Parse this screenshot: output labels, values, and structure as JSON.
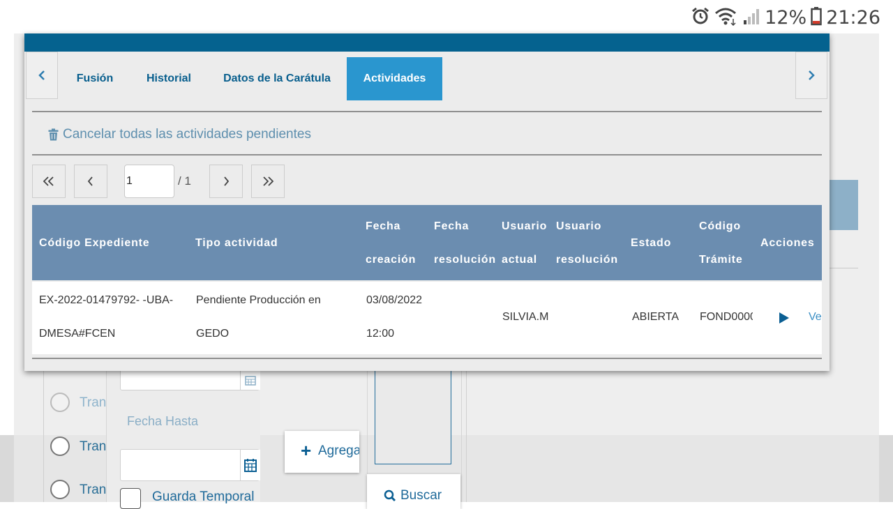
{
  "status_bar": {
    "battery": "12%",
    "time": "21:26"
  },
  "modal": {
    "tabs": [
      {
        "label": "Fusión",
        "active": false
      },
      {
        "label": "Historial",
        "active": false
      },
      {
        "label": "Datos de la Carátula",
        "active": false
      },
      {
        "label": "Actividades",
        "active": true
      }
    ],
    "cancel_all_label": "Cancelar todas las actividades pendientes",
    "pagination": {
      "page": "1",
      "total": "/ 1"
    },
    "table": {
      "headers": [
        {
          "l1": "Código Expediente",
          "l2": ""
        },
        {
          "l1": "Tipo actividad",
          "l2": ""
        },
        {
          "l1": "Fecha",
          "l2": "creación"
        },
        {
          "l1": "Fecha",
          "l2": "resolución"
        },
        {
          "l1": "Usuario",
          "l2": "actual"
        },
        {
          "l1": "Usuario",
          "l2": "resolución"
        },
        {
          "l1": "Estado",
          "l2": ""
        },
        {
          "l1": "Código",
          "l2": "Trámite"
        },
        {
          "l1": "Acciones",
          "l2": ""
        }
      ],
      "rows": [
        {
          "codigo_l1": "EX-2022-01479792- -UBA-",
          "codigo_l2": "DMESA#FCEN",
          "tipo_l1": "Pendiente Producción en",
          "tipo_l2": "GEDO",
          "fecha_creacion_l1": "03/08/2022",
          "fecha_creacion_l2": "12:00",
          "fecha_resolucion": "",
          "usuario_actual": "SILVIA.M",
          "usuario_resolucion": "",
          "estado": "ABIERTA",
          "codigo_tramite": "FOND0000",
          "accion_link": "Ve"
        }
      ]
    }
  },
  "background_form": {
    "radio_labels": [
      "Tran",
      "Tran",
      "Tran"
    ],
    "fecha_hasta_label": "Fecha Hasta",
    "agregar_label": "Agrega",
    "buscar_label": "Buscar",
    "guarda_temporal_label": "Guarda Temporal"
  },
  "colors": {
    "header_blue": "#05628f",
    "active_tab": "#2a96cf",
    "table_header": "#6b8db0",
    "link_blue": "#075e8d"
  }
}
